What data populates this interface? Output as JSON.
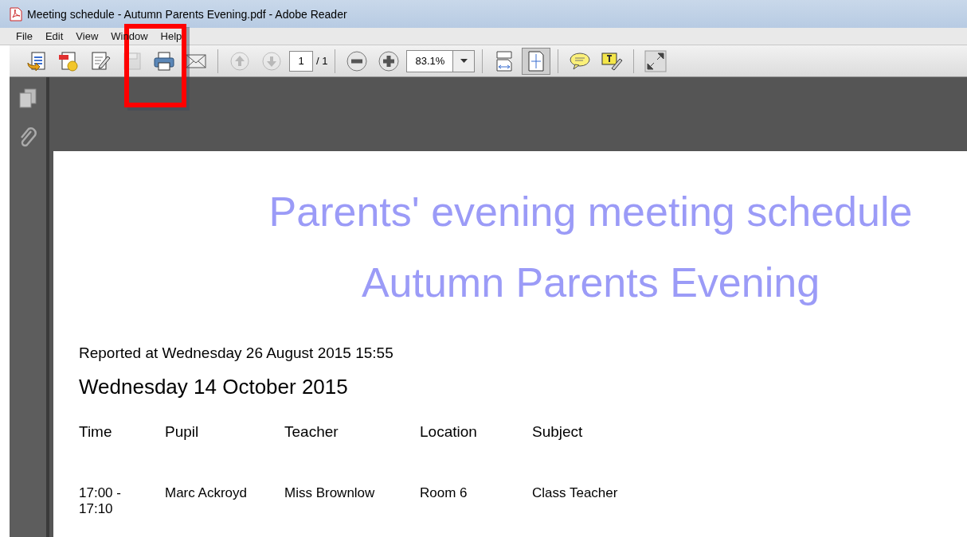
{
  "window": {
    "title": "Meeting schedule - Autumn Parents Evening.pdf - Adobe Reader"
  },
  "menu": [
    "File",
    "Edit",
    "View",
    "Window",
    "Help"
  ],
  "toolbar": [
    {
      "kind": "open",
      "disabled": false,
      "selected": false
    },
    {
      "kind": "create",
      "disabled": false,
      "selected": false
    },
    {
      "kind": "edit",
      "disabled": false,
      "selected": false
    },
    {
      "kind": "save",
      "disabled": true,
      "selected": false
    },
    {
      "kind": "print",
      "disabled": false,
      "selected": false
    },
    {
      "kind": "email",
      "disabled": false,
      "selected": false
    },
    {
      "kind": "separator"
    },
    {
      "kind": "up",
      "disabled": true,
      "selected": false
    },
    {
      "kind": "down",
      "disabled": true,
      "selected": false
    },
    {
      "kind": "page",
      "value": "1",
      "total": "/ 1"
    },
    {
      "kind": "separator"
    },
    {
      "kind": "zoom-out",
      "disabled": false,
      "selected": false
    },
    {
      "kind": "zoom-in",
      "disabled": false,
      "selected": false
    },
    {
      "kind": "zoom",
      "value": "83.1%"
    },
    {
      "kind": "separator"
    },
    {
      "kind": "fit-width",
      "disabled": false,
      "selected": false
    },
    {
      "kind": "fit-page",
      "disabled": false,
      "selected": true
    },
    {
      "kind": "separator"
    },
    {
      "kind": "comment",
      "disabled": false,
      "selected": false
    },
    {
      "kind": "highlight",
      "disabled": false,
      "selected": false
    },
    {
      "kind": "separator"
    },
    {
      "kind": "expand",
      "disabled": false,
      "selected": false
    }
  ],
  "document": {
    "title": "Parents' evening meeting schedule",
    "subtitle": "Autumn Parents Evening",
    "reported": "Reported at Wednesday 26 August 2015 15:55",
    "date": "Wednesday 14 October 2015",
    "table": {
      "columns": [
        "Time",
        "Pupil",
        "Teacher",
        "Location",
        "Subject"
      ],
      "rows": [
        [
          "17:00 - 17:10",
          "Marc Ackroyd",
          "Miss Brownlow",
          "Room 6",
          "Class Teacher"
        ]
      ]
    }
  }
}
